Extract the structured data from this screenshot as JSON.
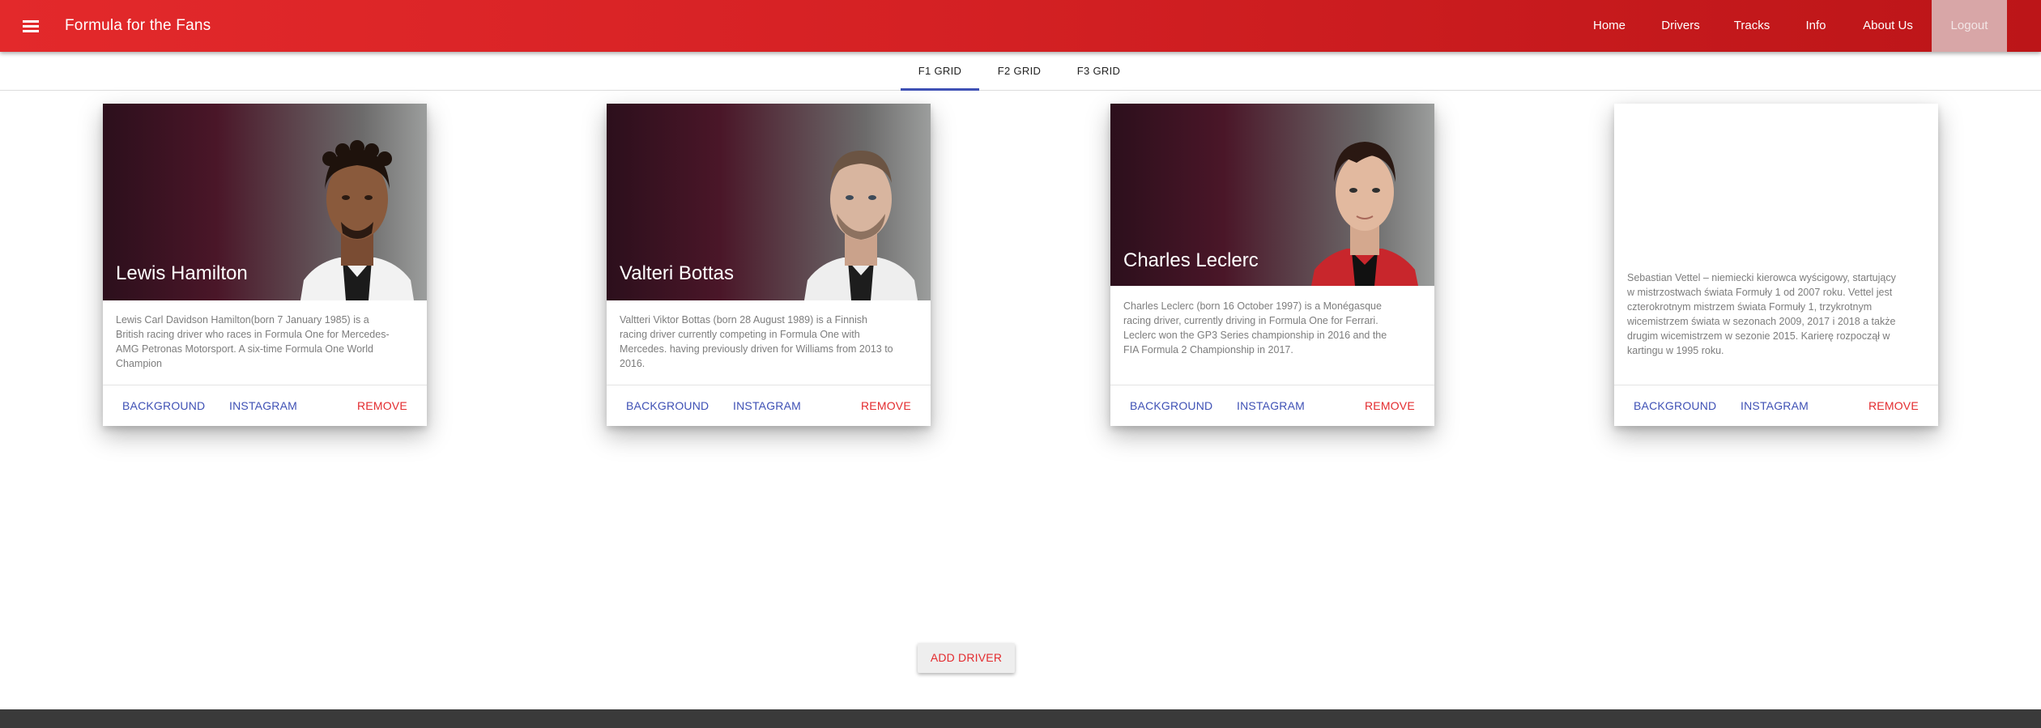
{
  "appbar": {
    "title": "Formula for the Fans",
    "nav": [
      "Home",
      "Drivers",
      "Tracks",
      "Info",
      "About Us",
      "Logout"
    ]
  },
  "tabs": [
    "F1 GRID",
    "F2 GRID",
    "F3 GRID"
  ],
  "selected_tab": "F1 GRID",
  "cards": [
    {
      "name": "Lewis Hamilton",
      "description": "Lewis Carl Davidson Hamilton(born 7 January 1985) is a British racing driver who races in Formula One for Mercedes-AMG Petronas Motorsport. A six-time Formula One World Champion",
      "actions": [
        "BACKGROUND",
        "INSTAGRAM",
        "REMOVE"
      ]
    },
    {
      "name": "Valteri Bottas",
      "description": "Valtteri Viktor Bottas (born 28 August 1989) is a Finnish racing driver currently competing in Formula One with Mercedes. having previously driven for Williams from 2013 to 2016.",
      "actions": [
        "BACKGROUND",
        "INSTAGRAM",
        "REMOVE"
      ]
    },
    {
      "name": "Charles Leclerc",
      "description": "Charles Leclerc (born 16 October 1997) is a Monégasque racing driver, currently driving in Formula One for Ferrari. Leclerc won the GP3 Series championship in 2016 and the FIA Formula 2 Championship in 2017.",
      "actions": [
        "BACKGROUND",
        "INSTAGRAM",
        "REMOVE"
      ]
    },
    {
      "name": "",
      "description": "Sebastian Vettel – niemiecki kierowca wyścigowy, startujący w mistrzostwach świata Formuły 1 od 2007 roku. Vettel jest czterokrotnym mistrzem świata Formuły 1, trzykrotnym wicemistrzem świata w sezonach 2009, 2017 i 2018 a także drugim wicemistrzem w sezonie 2015. Karierę rozpoczął w kartingu w 1995 roku.",
      "actions": [
        "BACKGROUND",
        "INSTAGRAM",
        "REMOVE"
      ]
    }
  ],
  "add_driver_label": "ADD DRIVER",
  "colors": {
    "appbar": "#d52124",
    "accent_blue": "#3f51b5",
    "accent_red": "#e32b2e",
    "footer": "#3a3a3a"
  }
}
